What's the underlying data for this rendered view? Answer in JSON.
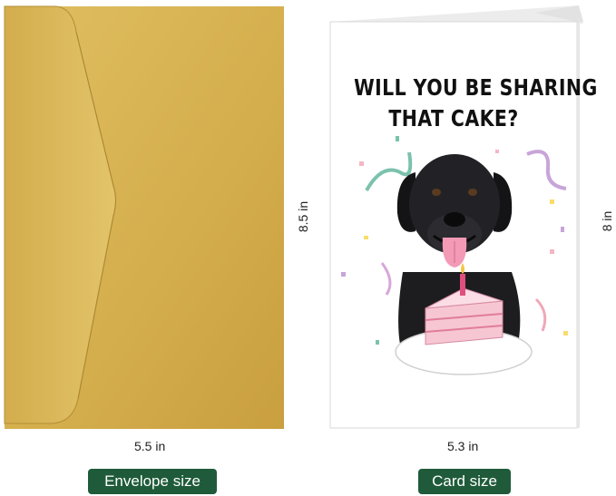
{
  "envelope": {
    "width_label": "5.5 in",
    "height_label": "8.5 in",
    "badge": "Envelope size",
    "color": "#d9b453"
  },
  "card": {
    "line1": "WILL YOU BE SHARING",
    "line2": "THAT CAKE?",
    "width_label": "5.3 in",
    "height_label": "8 in",
    "badge": "Card size",
    "accent": "#f4b6c6"
  },
  "badge_color": "#1f5b3a"
}
